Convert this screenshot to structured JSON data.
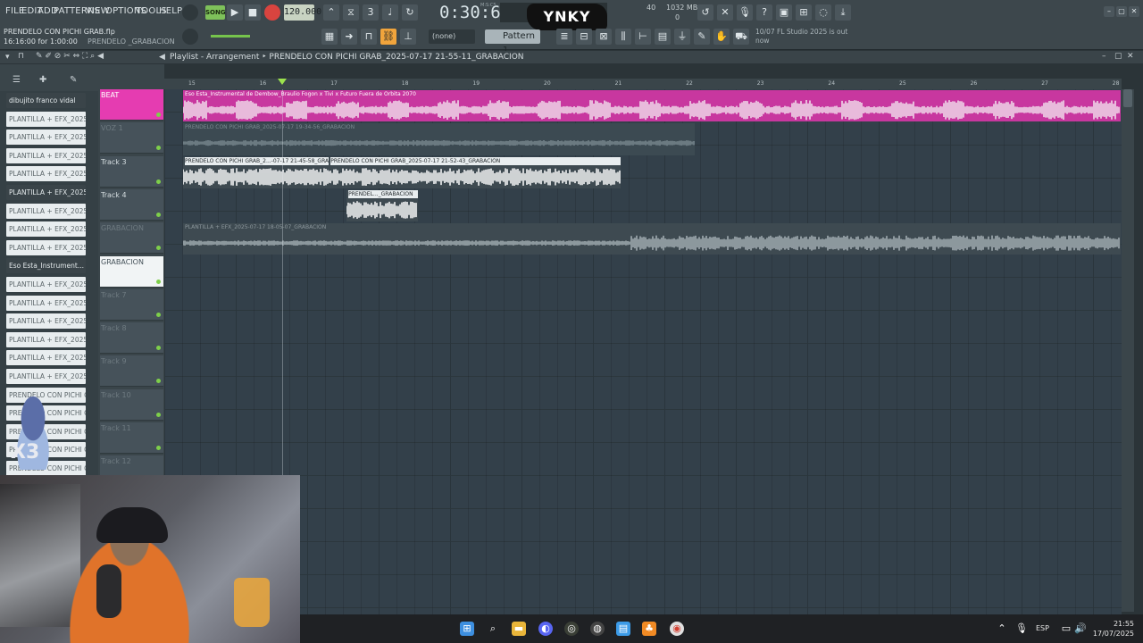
{
  "menu": [
    "FILE",
    "EDIT",
    "ADD",
    "PATTERNS",
    "VIEW",
    "OPTIONS",
    "TOOLS",
    "HELP"
  ],
  "transport": {
    "song_label": "SONG",
    "tempo": "120.000",
    "time": "0:30:65",
    "time_label": "M:S:CS"
  },
  "memory": {
    "cpu": "40",
    "ram": "1032 MB",
    "voices": "0"
  },
  "logo_text": "YNKY",
  "project": {
    "file": "PRENDELO CON PICHI GRAB.flp",
    "time": "16:16:00 for 1:00:00",
    "name": "PRENDELO _GRABACION"
  },
  "pattern": {
    "none_label": "(none)",
    "pattern_label": "Pattern 1"
  },
  "news": {
    "date": "10/07",
    "text": "FL Studio 2025 is out now"
  },
  "playlist": {
    "title": "Playlist - Arrangement ‣ PRENDELO CON PICHI GRAB_2025-07-17 21-55-11_GRABACION"
  },
  "browser": {
    "items": [
      {
        "label": "dibujito franco vidal",
        "dark": true
      },
      {
        "label": "PLANTILLA + EFX_2025-0...",
        "dark": false
      },
      {
        "label": "PLANTILLA + EFX_2025-0...",
        "dark": false
      },
      {
        "label": "PLANTILLA + EFX_2025-0...",
        "dark": false
      },
      {
        "label": "PLANTILLA + EFX_2025-0...",
        "dark": false
      },
      {
        "label": "PLANTILLA + EFX_2025-0...",
        "dark": true
      },
      {
        "label": "PLANTILLA + EFX_2025-0...",
        "dark": false
      },
      {
        "label": "PLANTILLA + EFX_2025-0...",
        "dark": false
      },
      {
        "label": "PLANTILLA + EFX_2025-0...",
        "dark": false
      },
      {
        "label": "Eso Esta_Instrument...",
        "dark": true
      },
      {
        "label": "PLANTILLA + EFX_2025-0...",
        "dark": false
      },
      {
        "label": "PLANTILLA + EFX_2025-0...",
        "dark": false
      },
      {
        "label": "PLANTILLA + EFX_2025-0...",
        "dark": false
      },
      {
        "label": "PLANTILLA + EFX_2025-0...",
        "dark": false
      },
      {
        "label": "PLANTILLA + EFX_2025-0...",
        "dark": false
      },
      {
        "label": "PLANTILLA + EFX_2025-01",
        "dark": false
      },
      {
        "label": "PRENDELO CON PICHI GRA...",
        "dark": false
      },
      {
        "label": "PRENDELO CON PICHI GRA...",
        "dark": false
      },
      {
        "label": "PRENDELO CON PICHI GRA...",
        "dark": false
      },
      {
        "label": "PRENDELO CON PICHI GRA...",
        "dark": false
      },
      {
        "label": "PRENDELO CON PICHI GRA...",
        "dark": false
      }
    ]
  },
  "tracks": [
    {
      "name": "BEAT",
      "style": "pink"
    },
    {
      "name": "VOZ 1",
      "style": "muted"
    },
    {
      "name": "Track 3",
      "style": "normal"
    },
    {
      "name": "Track 4",
      "style": "normal"
    },
    {
      "name": "GRABACION",
      "style": "muted"
    },
    {
      "name": "GRABACION",
      "style": "white"
    },
    {
      "name": "Track 7",
      "style": "muted"
    },
    {
      "name": "Track 8",
      "style": "muted"
    },
    {
      "name": "Track 9",
      "style": "muted"
    },
    {
      "name": "Track 10",
      "style": "muted"
    },
    {
      "name": "Track 11",
      "style": "muted"
    },
    {
      "name": "Track 12",
      "style": "muted"
    }
  ],
  "bars": [
    "15",
    "16",
    "17",
    "18",
    "19",
    "20",
    "21",
    "22",
    "23",
    "24",
    "25",
    "26",
    "27",
    "28"
  ],
  "clips": [
    {
      "track": 0,
      "start_bar": 14.9,
      "end_bar": 28.1,
      "title": "Eso Esta_Instrumental de Dembow_Braulio Fogon x Tivi x Futuro Fuera de Orbita 2070",
      "color": "#c8379f",
      "wave": "#f3e6ef",
      "title_color": "#ffffff"
    },
    {
      "track": 1,
      "start_bar": 14.9,
      "end_bar": 22.1,
      "title": "PRENDELO CON PICHI GRAB_2025-07-17 19-34-56_GRABACION",
      "color": "#3c4a52",
      "wave": "#7b8a91",
      "title_color": "#7b8a91"
    },
    {
      "track": 2,
      "start_bar": 14.9,
      "end_bar": 16.95,
      "title": "PRENDELO CON PICHI GRAB_2...-07-17 21-45-58_GRABACI",
      "color": "#3e4a51",
      "wave": "#ffffff",
      "title_color": "#23292c"
    },
    {
      "track": 2,
      "start_bar": 16.95,
      "end_bar": 21.05,
      "title": "PRENDELO CON PICHI GRAB_2025-07-17 21-52-43_GRABACION",
      "color": "#3e4a51",
      "wave": "#ffffff",
      "title_color": "#23292c"
    },
    {
      "track": 3,
      "start_bar": 17.2,
      "end_bar": 18.2,
      "title": "PRENDEL..._GRABACION",
      "color": "#3e4a51",
      "wave": "#ffffff",
      "title_color": "#23292c"
    },
    {
      "track": 4,
      "start_bar": 14.9,
      "end_bar": 28.1,
      "title": "PLANTILLA + EFX_2025-07-17 18-05-07_GRABACION",
      "color": "#3e4a51",
      "wave": "#a7b2b7",
      "title_color": "#8d989d"
    }
  ],
  "taskbar": {
    "lang": "ESP",
    "time": "21:55",
    "date": "17/07/2025"
  },
  "sticker_text": "X3"
}
